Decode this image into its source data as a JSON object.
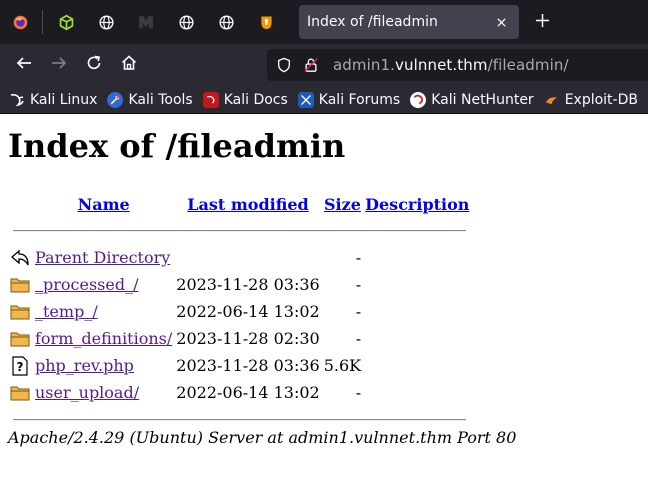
{
  "browser": {
    "active_tab": {
      "title": "Index of /fileadmin",
      "close_icon": "close-icon"
    },
    "pinned_tabs": [
      {
        "name": "firefox-icon"
      },
      {
        "name": "green-cube-icon"
      },
      {
        "name": "globe-icon"
      },
      {
        "name": "m-logo-icon",
        "text": "M"
      },
      {
        "name": "globe-icon"
      },
      {
        "name": "globe-icon"
      },
      {
        "name": "typo3-icon"
      }
    ],
    "new_tab_icon": "plus-icon",
    "nav": {
      "back_icon": "back-arrow-icon",
      "forward_icon": "forward-arrow-icon",
      "reload_icon": "reload-icon",
      "home_icon": "home-icon"
    },
    "url": {
      "prefix": "admin1.",
      "domain": "vulnnet.thm",
      "path": "/fileadmin/",
      "shield_icon": "shield-icon",
      "lock_icon": "insecure-lock-icon"
    },
    "bookmarks": [
      {
        "label": "Kali Linux",
        "icon": "kali-dragon-icon"
      },
      {
        "label": "Kali Tools",
        "icon": "kali-tools-icon"
      },
      {
        "label": "Kali Docs",
        "icon": "kali-docs-icon"
      },
      {
        "label": "Kali Forums",
        "icon": "kali-forums-icon"
      },
      {
        "label": "Kali NetHunter",
        "icon": "nethunter-icon"
      },
      {
        "label": "Exploit-DB",
        "icon": "exploit-db-icon"
      }
    ]
  },
  "page": {
    "title": "Index of /fileadmin",
    "columns": {
      "name": "Name",
      "last_modified": "Last modified",
      "size": "Size",
      "description": "Description"
    },
    "entries": [
      {
        "icon": "back-icon",
        "name": "Parent Directory",
        "modified": "",
        "size": "-"
      },
      {
        "icon": "folder-icon",
        "name": "_processed_/",
        "modified": "2023-11-28 03:36",
        "size": "-"
      },
      {
        "icon": "folder-icon",
        "name": "_temp_/",
        "modified": "2022-06-14 13:02",
        "size": "-"
      },
      {
        "icon": "folder-icon",
        "name": "form_definitions/",
        "modified": "2023-11-28 02:30",
        "size": "-"
      },
      {
        "icon": "unknown-file-icon",
        "name": "php_rev.php",
        "modified": "2023-11-28 03:36",
        "size": "5.6K"
      },
      {
        "icon": "folder-icon",
        "name": "user_upload/",
        "modified": "2022-06-14 13:02",
        "size": "-"
      }
    ],
    "server_signature": "Apache/2.4.29 (Ubuntu) Server at admin1.vulnnet.thm Port 80"
  },
  "colors": {
    "tabbar_bg": "#1c1b22",
    "toolbar_bg": "#2b2a33",
    "link_visited": "#551a8b",
    "link": "#0000ee"
  }
}
